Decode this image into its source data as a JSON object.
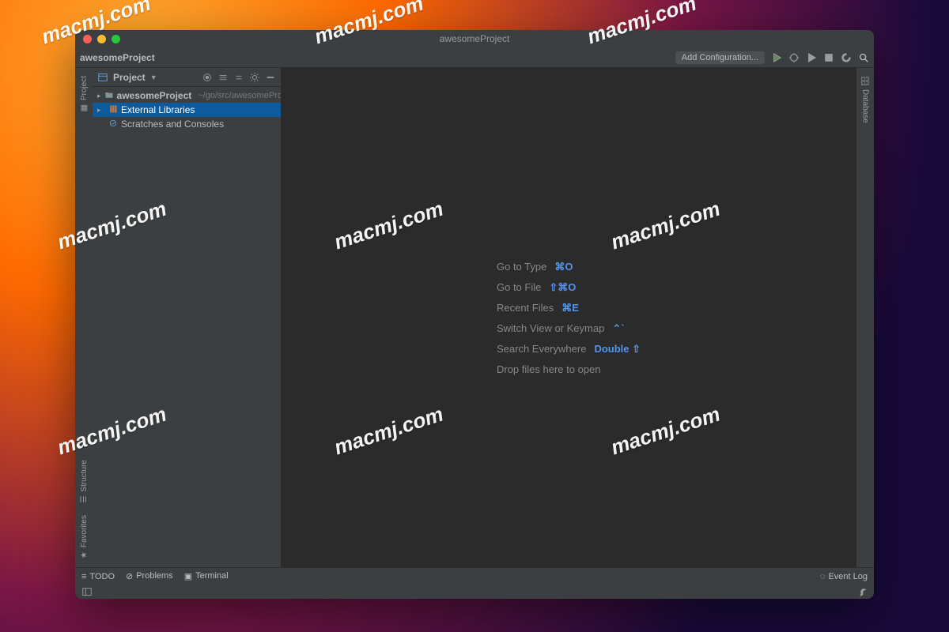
{
  "watermark_text": "macmj.com",
  "window": {
    "title": "awesomeProject",
    "breadcrumb": "awesomeProject"
  },
  "toolbar": {
    "add_config": "Add Configuration..."
  },
  "left_gutter": {
    "project": "Project",
    "structure": "Structure",
    "favorites": "Favorites"
  },
  "right_gutter": {
    "database": "Database"
  },
  "sidebar": {
    "header": "Project",
    "root": {
      "name": "awesomeProject",
      "path": "~/go/src/awesomeProject"
    },
    "ext_libs": "External Libraries",
    "scratches": "Scratches and Consoles"
  },
  "hints": {
    "goto_type": {
      "label": "Go to Type",
      "key": "⌘O"
    },
    "goto_file": {
      "label": "Go to File",
      "key": "⇧⌘O"
    },
    "recent": {
      "label": "Recent Files",
      "key": "⌘E"
    },
    "switch": {
      "label": "Switch View or Keymap",
      "key": "⌃`"
    },
    "search": {
      "label": "Search Everywhere",
      "key": "Double ⇧"
    },
    "drop": "Drop files here to open"
  },
  "status": {
    "todo": "TODO",
    "problems": "Problems",
    "terminal": "Terminal",
    "event_log": "Event Log"
  }
}
